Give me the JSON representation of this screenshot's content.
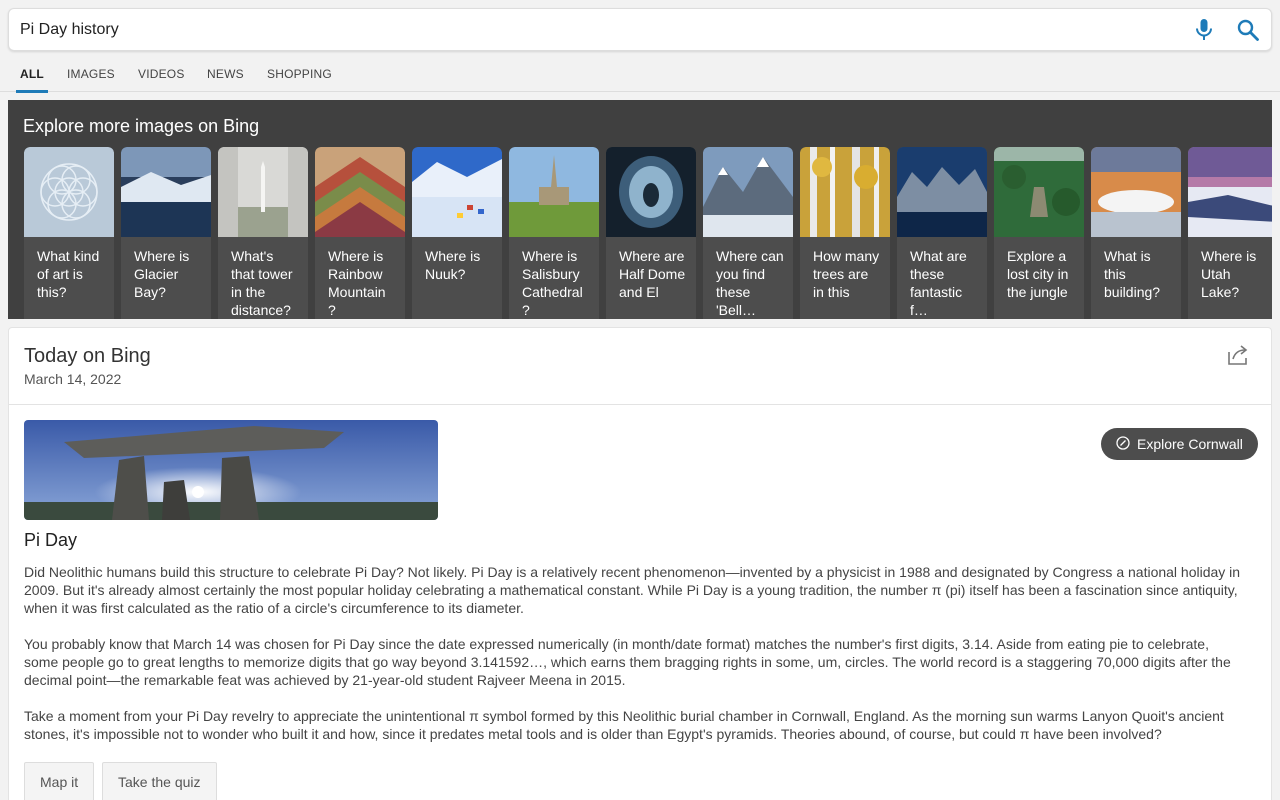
{
  "search": {
    "query": "Pi Day history",
    "mic_icon": "microphone-icon",
    "search_icon": "magnifier-icon"
  },
  "tabs": [
    {
      "label": "ALL",
      "active": true
    },
    {
      "label": "IMAGES",
      "active": false
    },
    {
      "label": "VIDEOS",
      "active": false
    },
    {
      "label": "NEWS",
      "active": false
    },
    {
      "label": "SHOPPING",
      "active": false
    }
  ],
  "explore": {
    "title": "Explore more images on Bing",
    "cards": [
      {
        "caption": "What kind of art is this?"
      },
      {
        "caption": "Where is Glacier Bay?"
      },
      {
        "caption": "What's that tower in the distance?"
      },
      {
        "caption": "Where is Rainbow Mountain ?"
      },
      {
        "caption": "Where is Nuuk?"
      },
      {
        "caption": "Where is Salisbury Cathedral ?"
      },
      {
        "caption": "Where are Half Dome and El"
      },
      {
        "caption": "Where can you find these 'Bell…"
      },
      {
        "caption": "How many trees are in this"
      },
      {
        "caption": "What are these fantastic f…"
      },
      {
        "caption": "Explore a lost city in the jungle"
      },
      {
        "caption": "What is this building?"
      },
      {
        "caption": "Where is Utah Lake?"
      }
    ]
  },
  "today": {
    "title": "Today on Bing",
    "date": "March 14, 2022",
    "share_icon": "share-icon",
    "explore_button": "Explore Cornwall",
    "article_title": "Pi Day",
    "paragraphs": [
      "Did Neolithic humans build this structure to celebrate Pi Day? Not likely. Pi Day is a relatively recent phenomenon—invented by a physicist in 1988 and designated by Congress a national holiday in 2009. But it's already almost certainly the most popular holiday celebrating a mathematical constant. While Pi Day is a young tradition, the number π (pi) itself has been a fascination since antiquity, when it was first calculated as the ratio of a circle's circumference to its diameter.",
      "You probably know that March 14 was chosen for Pi Day since the date expressed numerically (in month/date format) matches the number's first digits, 3.14. Aside from eating pie to celebrate, some people go to great lengths to memorize digits that go way beyond 3.141592…, which earns them bragging rights in some, um, circles. The world record is a staggering 70,000 digits after the decimal point—the remarkable feat was achieved by 21-year-old student Rajveer Meena in 2015.",
      "Take a moment from your Pi Day revelry to appreciate the unintentional π symbol formed by this Neolithic burial chamber in Cornwall, England. As the morning sun warms Lanyon Quoit's ancient stones, it's impossible not to wonder who built it and how, since it predates metal tools and is older than Egypt's pyramids. Theories abound, of course, but could π have been involved?"
    ],
    "buttons": {
      "map": "Map it",
      "quiz": "Take the quiz"
    }
  },
  "colors": {
    "accent": "#1e7bb8",
    "carousel_bg": "#404040",
    "pill_bg": "#4d4d4d"
  }
}
